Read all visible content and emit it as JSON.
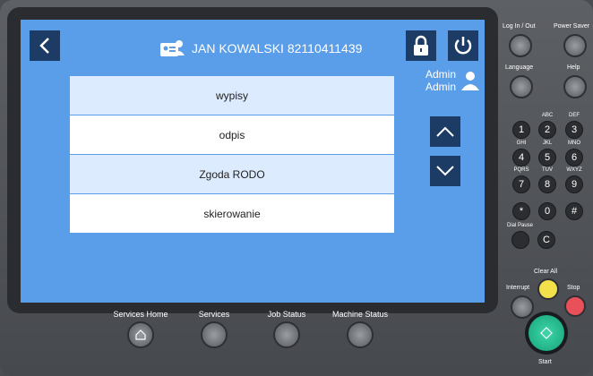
{
  "header": {
    "user_label": "JAN KOWALSKI 82110411439"
  },
  "admin": {
    "line1": "Admin",
    "line2": "Admin"
  },
  "menu": {
    "items": [
      "wypisy",
      "odpis",
      "Zgoda RODO",
      "skierowanie"
    ]
  },
  "hardware": {
    "bottom": [
      "Services Home",
      "Services",
      "Job Status",
      "Machine Status"
    ],
    "login": "Log In / Out",
    "power_saver": "Power Saver",
    "language": "Language",
    "help": "Help",
    "keypad": [
      {
        "d": "1",
        "s": ""
      },
      {
        "d": "2",
        "s": "ABC"
      },
      {
        "d": "3",
        "s": "DEF"
      },
      {
        "d": "4",
        "s": "GHI"
      },
      {
        "d": "5",
        "s": "JKL"
      },
      {
        "d": "6",
        "s": "MNO"
      },
      {
        "d": "7",
        "s": "PQRS"
      },
      {
        "d": "8",
        "s": "TUV"
      },
      {
        "d": "9",
        "s": "WXYZ"
      },
      {
        "d": "*",
        "s": ""
      },
      {
        "d": "0",
        "s": ""
      },
      {
        "d": "#",
        "s": ""
      }
    ],
    "dial_pause": "Dial Pause",
    "c_key": "C",
    "clear_all": "Clear All",
    "interrupt": "Interrupt",
    "stop": "Stop",
    "start": "Start"
  },
  "colors": {
    "screen": "#5a9de8",
    "button_dark": "#1c3c66",
    "row_alt": "#dcebfd",
    "clear_all": "#f2e14a",
    "stop": "#e8505a",
    "start": "#1fb489"
  }
}
